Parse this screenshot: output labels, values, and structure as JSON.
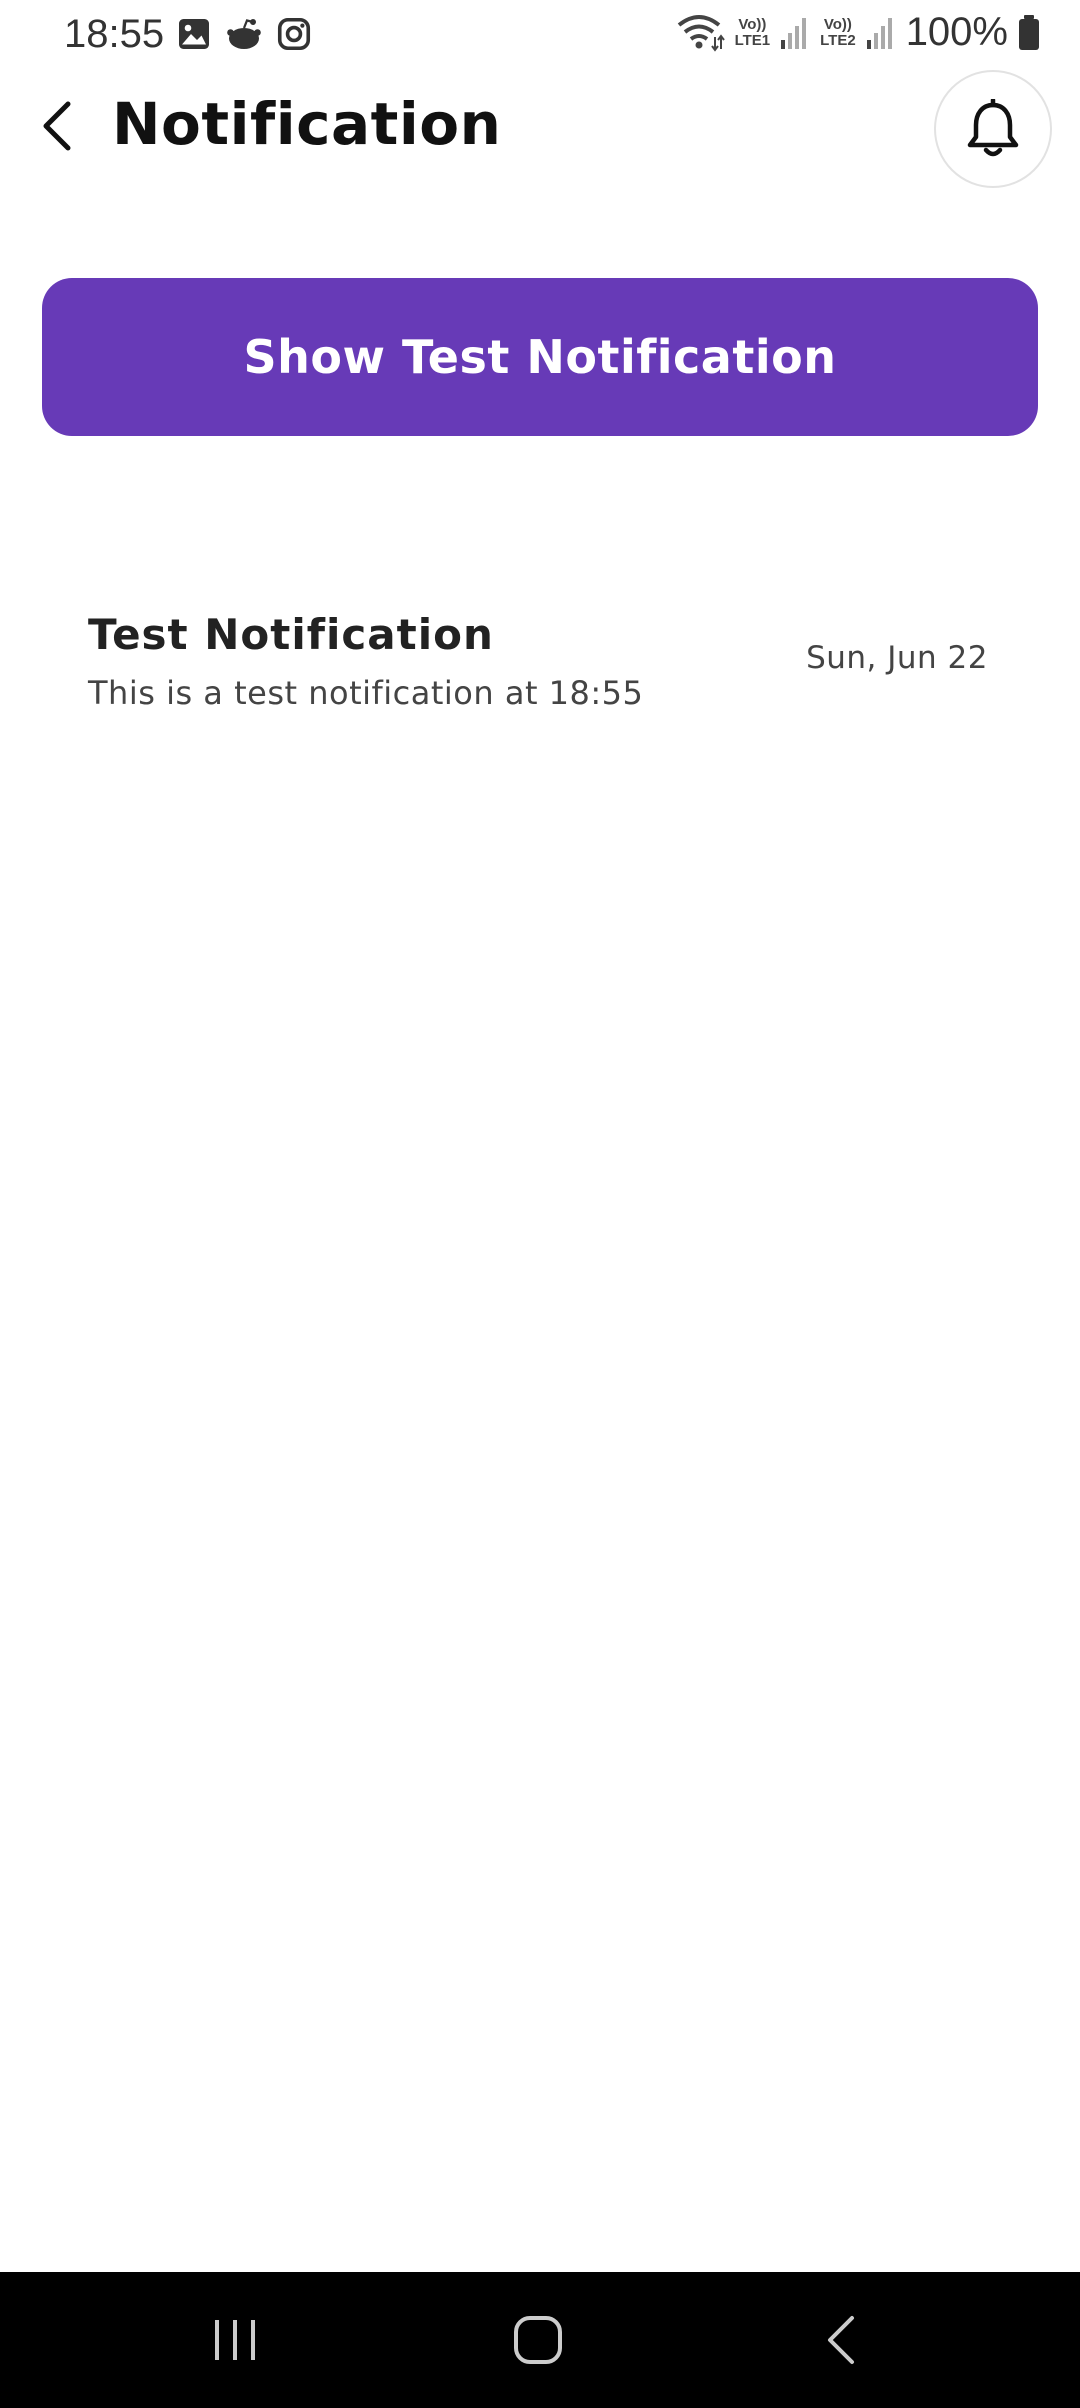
{
  "status_bar": {
    "time": "18:55",
    "left_icons": [
      "gallery-icon",
      "reddit-icon",
      "instagram-icon"
    ],
    "network_1": {
      "top": "Vo))",
      "bottom": "LTE1"
    },
    "network_2": {
      "top": "Vo))",
      "bottom": "LTE2"
    },
    "battery": "100%"
  },
  "header": {
    "title": "Notification"
  },
  "primary_button": {
    "label": "Show Test Notification",
    "color": "#673ab7"
  },
  "notifications": [
    {
      "title": "Test Notification",
      "body": "This is a test notification at 18:55",
      "date": "Sun, Jun 22"
    }
  ]
}
